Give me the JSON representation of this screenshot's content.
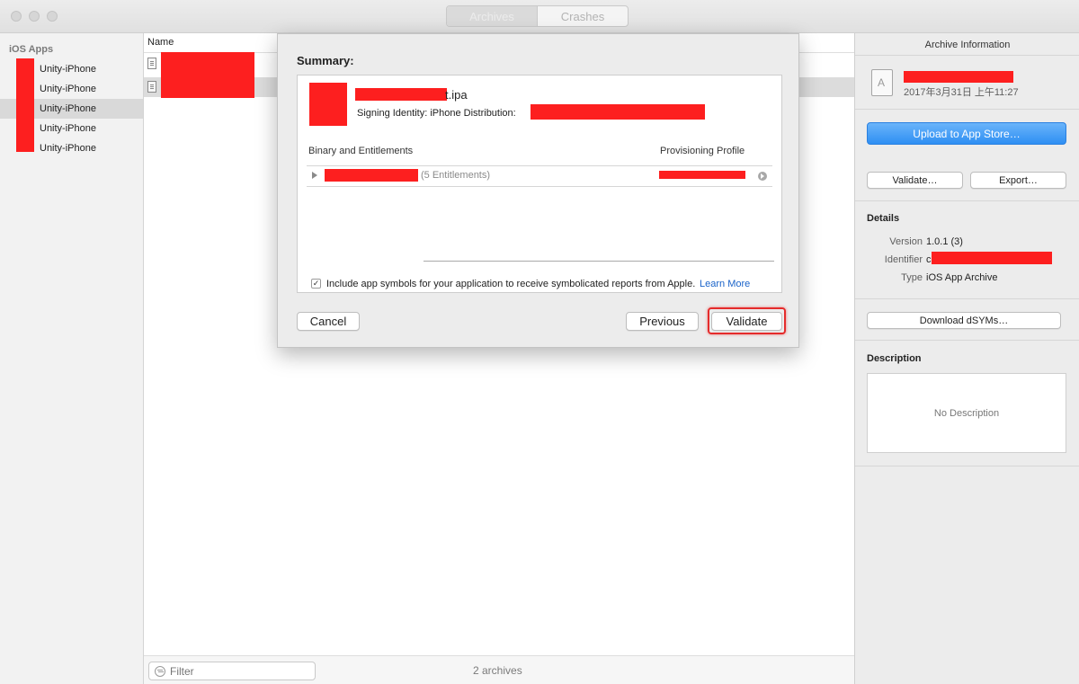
{
  "window": {
    "tabs": [
      {
        "label": "Archives",
        "active": true
      },
      {
        "label": "Crashes",
        "active": false
      }
    ]
  },
  "sidebar": {
    "header": "iOS Apps",
    "items": [
      {
        "label": "Unity-iPhone",
        "selected": false
      },
      {
        "label": "Unity-iPhone",
        "selected": false
      },
      {
        "label": "Unity-iPhone",
        "selected": true
      },
      {
        "label": "Unity-iPhone",
        "selected": false
      },
      {
        "label": "Unity-iPhone",
        "selected": false
      }
    ]
  },
  "list": {
    "column_name": "Name",
    "filter_placeholder": "Filter",
    "archive_count": "2 archives"
  },
  "sheet": {
    "title": "Summary:",
    "ipa_suffix": "t.ipa",
    "signing_label": "Signing Identity: iPhone Distribution:",
    "col_binary": "Binary and Entitlements",
    "col_profile": "Provisioning Profile",
    "entitlements": "(5 Entitlements)",
    "include_symbols_label": "Include app symbols for your application to receive symbolicated reports from Apple.",
    "include_symbols_checked": true,
    "learn_more": "Learn More",
    "cancel": "Cancel",
    "previous": "Previous",
    "validate": "Validate"
  },
  "inspector": {
    "title": "Archive Information",
    "date": "2017年3月31日 上午11:27",
    "upload": "Upload to App Store…",
    "validate": "Validate…",
    "export": "Export…",
    "details_title": "Details",
    "version_label": "Version",
    "version_value": "1.0.1 (3)",
    "identifier_label": "Identifier",
    "identifier_value": "c",
    "type_label": "Type",
    "type_value": "iOS App Archive",
    "download_dsyms": "Download dSYMs…",
    "description_title": "Description",
    "no_description": "No Description"
  },
  "colors": {
    "redaction": "#fd1f1f",
    "primary_button": "#2e8ff3",
    "highlight": "#e52b2b",
    "link": "#1a63c9"
  }
}
